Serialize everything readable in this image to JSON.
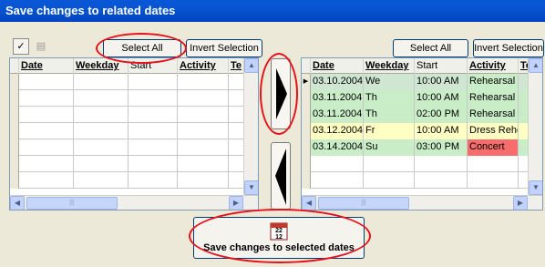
{
  "window": {
    "title": "Save changes to related dates"
  },
  "left_panel": {
    "select_all_label": "Select All",
    "invert_selection_label": "Invert Selection",
    "columns": [
      "Date",
      "Weekday",
      "Start",
      "Activity",
      "Te"
    ]
  },
  "right_panel": {
    "select_all_label": "Select All",
    "invert_selection_label": "Invert Selection",
    "columns": [
      "Date",
      "Weekday",
      "Start",
      "Activity",
      "Te"
    ],
    "rows": [
      {
        "date": "03.10.2004",
        "weekday": "We",
        "start": "10:00 AM",
        "activity": "Rehearsal",
        "color": "#c9eec7"
      },
      {
        "date": "03.11.2004",
        "weekday": "Th",
        "start": "10:00 AM",
        "activity": "Rehearsal",
        "color": "#c9eec7"
      },
      {
        "date": "03.11.2004",
        "weekday": "Th",
        "start": "02:00 PM",
        "activity": "Rehearsal",
        "color": "#c9eec7"
      },
      {
        "date": "03.12.2004",
        "weekday": "Fr",
        "start": "10:00 AM",
        "activity": "Dress Rehe",
        "color": "#ffffc4"
      },
      {
        "date": "03.14.2004",
        "weekday": "Su",
        "start": "03:00 PM",
        "activity": "Concert",
        "color": "#f76c6c"
      }
    ]
  },
  "save_button": {
    "label": "Save changes to selected dates",
    "icon_text": "22\n12"
  }
}
